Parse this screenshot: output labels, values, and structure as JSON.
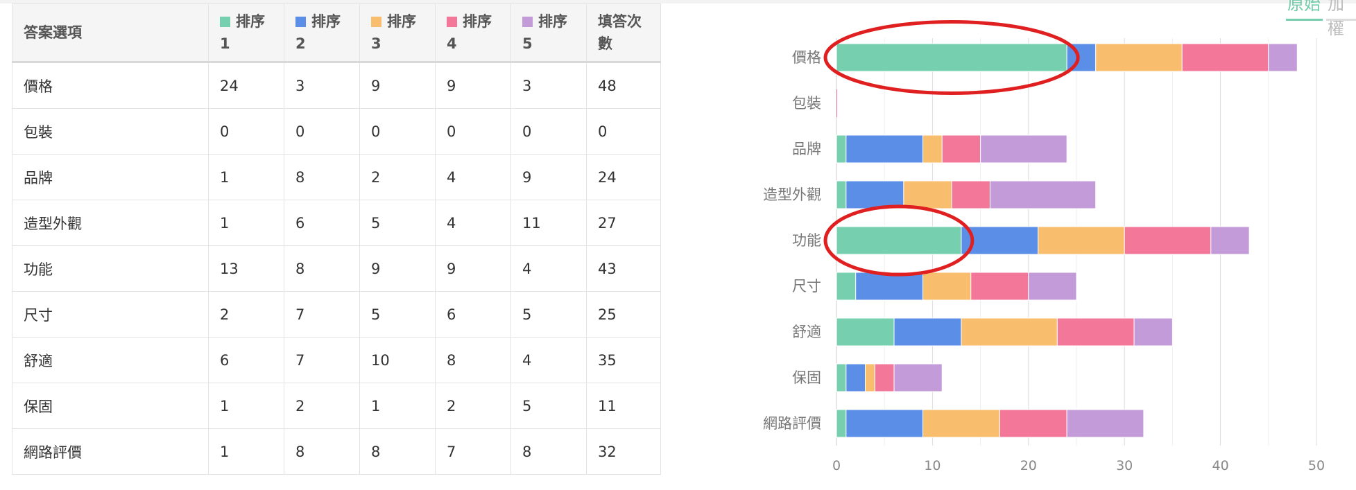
{
  "table": {
    "header_label": "答案選項",
    "rank_headers": [
      {
        "title": "排序",
        "num": "1"
      },
      {
        "title": "排序",
        "num": "2"
      },
      {
        "title": "排序",
        "num": "3"
      },
      {
        "title": "排序",
        "num": "4"
      },
      {
        "title": "排序",
        "num": "5"
      }
    ],
    "count_header": "填答次數",
    "rows": [
      {
        "label": "價格",
        "values": [
          "24",
          "3",
          "9",
          "9",
          "3"
        ],
        "count": "48"
      },
      {
        "label": "包裝",
        "values": [
          "0",
          "0",
          "0",
          "0",
          "0"
        ],
        "count": "0"
      },
      {
        "label": "品牌",
        "values": [
          "1",
          "8",
          "2",
          "4",
          "9"
        ],
        "count": "24"
      },
      {
        "label": "造型外觀",
        "values": [
          "1",
          "6",
          "5",
          "4",
          "11"
        ],
        "count": "27"
      },
      {
        "label": "功能",
        "values": [
          "13",
          "8",
          "9",
          "9",
          "4"
        ],
        "count": "43"
      },
      {
        "label": "尺寸",
        "values": [
          "2",
          "7",
          "5",
          "6",
          "5"
        ],
        "count": "25"
      },
      {
        "label": "舒適",
        "values": [
          "6",
          "7",
          "10",
          "8",
          "4"
        ],
        "count": "35"
      },
      {
        "label": "保固",
        "values": [
          "1",
          "2",
          "1",
          "2",
          "5"
        ],
        "count": "11"
      },
      {
        "label": "網路評價",
        "values": [
          "1",
          "8",
          "8",
          "7",
          "8"
        ],
        "count": "32"
      }
    ]
  },
  "tabs": [
    "原始",
    "加權"
  ],
  "colors": [
    "#76cfae",
    "#5b8ee6",
    "#f8bd6d",
    "#f27799",
    "#c39bd9"
  ],
  "highlight_color": "#e02020",
  "chart_data": {
    "type": "bar",
    "orientation": "horizontal",
    "stacked": true,
    "categories": [
      "價格",
      "包裝",
      "品牌",
      "造型外觀",
      "功能",
      "尺寸",
      "舒適",
      "保固",
      "網路評價"
    ],
    "series": [
      {
        "name": "排序 1",
        "values": [
          24,
          0,
          1,
          1,
          13,
          2,
          6,
          1,
          1
        ]
      },
      {
        "name": "排序 2",
        "values": [
          3,
          0,
          8,
          6,
          8,
          7,
          7,
          2,
          8
        ]
      },
      {
        "name": "排序 3",
        "values": [
          9,
          0,
          2,
          5,
          9,
          5,
          10,
          1,
          8
        ]
      },
      {
        "name": "排序 4",
        "values": [
          9,
          0,
          4,
          4,
          9,
          6,
          8,
          2,
          7
        ]
      },
      {
        "name": "排序 5",
        "values": [
          3,
          0,
          9,
          11,
          4,
          5,
          4,
          5,
          8
        ]
      }
    ],
    "xlim": [
      0,
      50
    ],
    "xticks": [
      0,
      10,
      20,
      30,
      40,
      50
    ],
    "grid": true,
    "annotations": [
      {
        "type": "ellipse",
        "category": "價格",
        "series": "排序 1"
      },
      {
        "type": "ellipse",
        "category": "功能",
        "series": "排序 1"
      }
    ]
  }
}
